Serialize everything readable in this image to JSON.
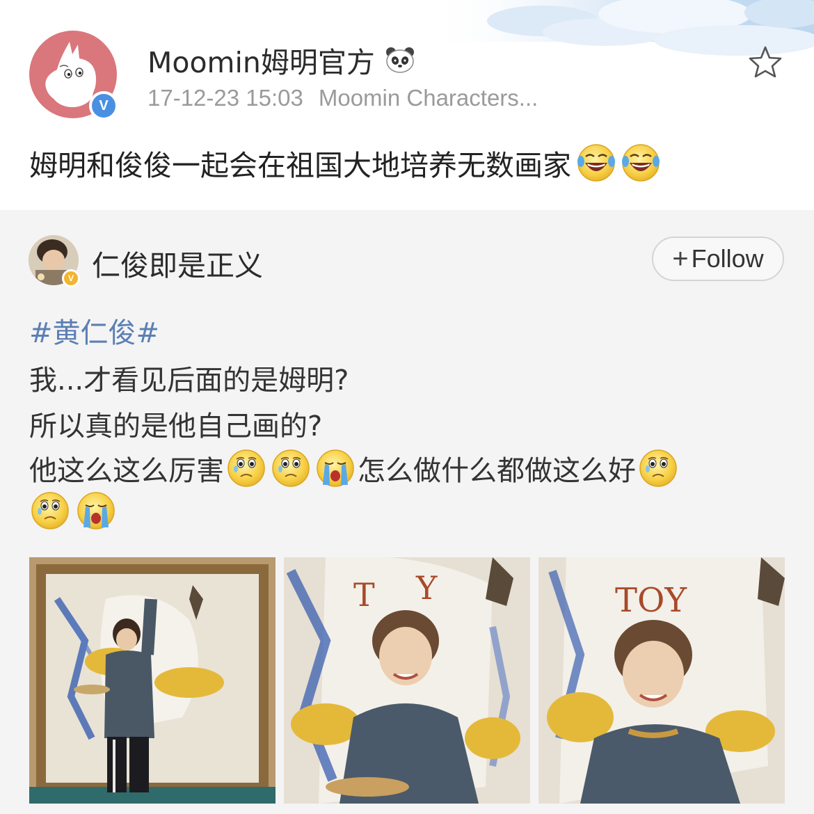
{
  "post": {
    "username": "Moomin姆明官方",
    "panda_badge_icon": "panda-icon",
    "timestamp": "17-12-23 15:03",
    "source": "Moomin Characters...",
    "text": "姆明和俊俊一起会在祖国大地培养无数画家",
    "emojis": [
      "laugh-cry-emoji",
      "laugh-cry-emoji"
    ],
    "verified_badge": "V",
    "star_icon": "star-outline-icon"
  },
  "repost": {
    "username": "仁俊即是正义",
    "verified_badge": "V",
    "follow_plus": "+",
    "follow_label": "Follow",
    "hashtag": "#黄仁俊#",
    "line1": "我...才看见后面的是姆明?",
    "line2": "所以真的是他自己画的?",
    "line3_a": "他这么这么厉害",
    "line3_b": "怎么做什么都做这么好",
    "line3_emojis": [
      "sad-emoji",
      "sad-emoji",
      "crying-emoji",
      "sad-emoji"
    ],
    "line4_emojis": [
      "sad-emoji",
      "crying-emoji"
    ],
    "photos": [
      {
        "description": "photo-painting-at-easel"
      },
      {
        "description": "photo-smiling-with-palette"
      },
      {
        "description": "photo-smiling-closeup"
      }
    ]
  },
  "colors": {
    "hashtag": "#5b7fb3",
    "verified_blue": "#4a90e2",
    "verified_gold": "#f3b52f",
    "repost_bg": "#f4f4f5",
    "avatar_main_bg": "#d9777c"
  }
}
